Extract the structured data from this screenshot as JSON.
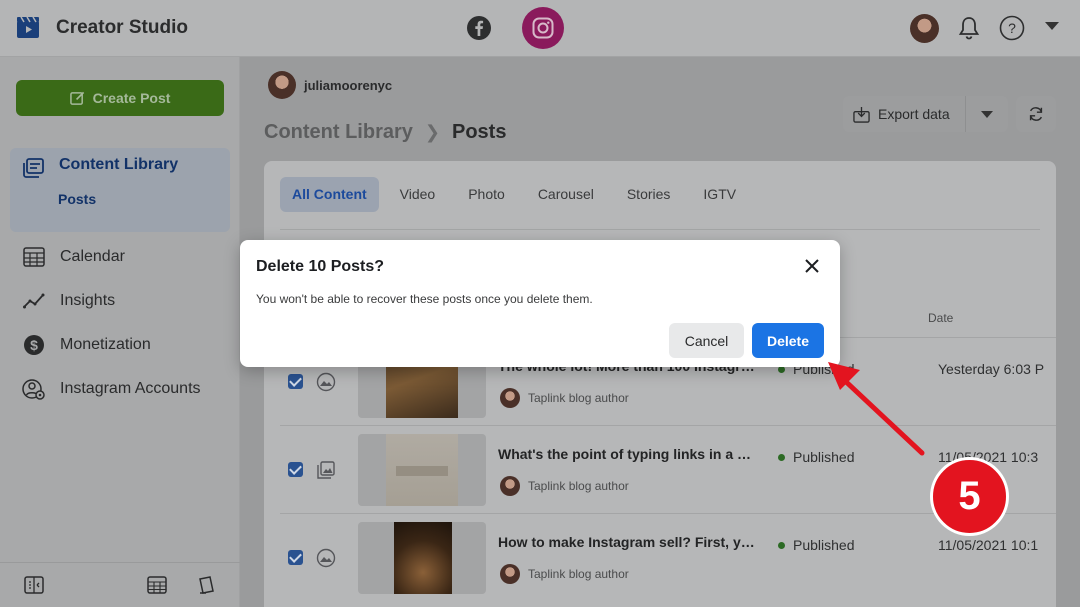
{
  "header": {
    "app_title": "Creator Studio",
    "platforms": [
      "facebook-icon",
      "instagram-icon"
    ],
    "active_platform": "instagram",
    "icons": [
      "bell-icon",
      "help-icon",
      "chevron-down-icon"
    ]
  },
  "sidebar": {
    "create_post_label": "Create Post",
    "active_item": {
      "label": "Content Library",
      "sub_label": "Posts"
    },
    "items": [
      {
        "label": "Calendar",
        "icon": "calendar-icon"
      },
      {
        "label": "Insights",
        "icon": "insights-icon"
      },
      {
        "label": "Monetization",
        "icon": "dollar-icon"
      },
      {
        "label": "Instagram Accounts",
        "icon": "accounts-gear-icon"
      }
    ]
  },
  "main": {
    "account_name": "juliamoorenyc",
    "breadcrumb": {
      "parent": "Content Library",
      "current": "Posts"
    },
    "export_label": "Export data",
    "tabs": [
      "All Content",
      "Video",
      "Photo",
      "Carousel",
      "Stories",
      "IGTV"
    ],
    "active_tab": "All Content",
    "columns": {
      "date": "Date"
    },
    "rows": [
      {
        "title": "The whole lot! More than 100 Instagr…",
        "author": "Taplink blog author",
        "status": "Published",
        "date": "Yesterday 6:03 P",
        "type_icon": "photo-icon",
        "checked": true
      },
      {
        "title": "What's the point of typing links in a po…",
        "author": "Taplink blog author",
        "status": "Published",
        "date": "11/05/2021 10:3",
        "type_icon": "carousel-icon",
        "checked": true
      },
      {
        "title": "How to make Instagram sell? First, yo…",
        "author": "Taplink blog author",
        "status": "Published",
        "date": "11/05/2021 10:1",
        "type_icon": "photo-icon",
        "checked": true
      }
    ]
  },
  "dialog": {
    "title": "Delete 10 Posts?",
    "message": "You won't be able to recover these posts once you delete them.",
    "cancel_label": "Cancel",
    "delete_label": "Delete"
  },
  "annotation": {
    "step_number": "5"
  },
  "colors": {
    "brand_blue": "#1b74e4",
    "create_green": "#3a6a17",
    "instagram": "#8a1a5c",
    "step_red": "#e3141f"
  }
}
